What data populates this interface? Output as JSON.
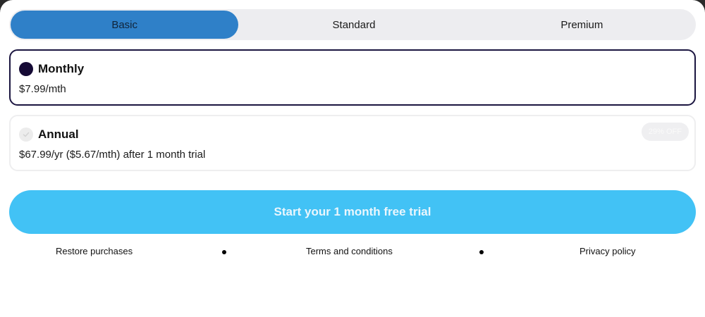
{
  "tabs": [
    {
      "label": "Basic",
      "active": true
    },
    {
      "label": "Standard",
      "active": false
    },
    {
      "label": "Premium",
      "active": false
    }
  ],
  "plans": {
    "monthly": {
      "title": "Monthly",
      "price": "$7.99/mth",
      "selected": true
    },
    "annual": {
      "title": "Annual",
      "price": "$67.99/yr ($5.67/mth) after 1 month trial",
      "badge": "29% OFF",
      "selected": false
    }
  },
  "cta": {
    "label": "Start your 1 month free trial"
  },
  "footer": {
    "restore": "Restore purchases",
    "terms": "Terms and conditions",
    "privacy": "Privacy policy"
  },
  "colors": {
    "accent_tab": "#2f80c8",
    "cta": "#42c2f5",
    "selected_border": "#1b1540"
  }
}
